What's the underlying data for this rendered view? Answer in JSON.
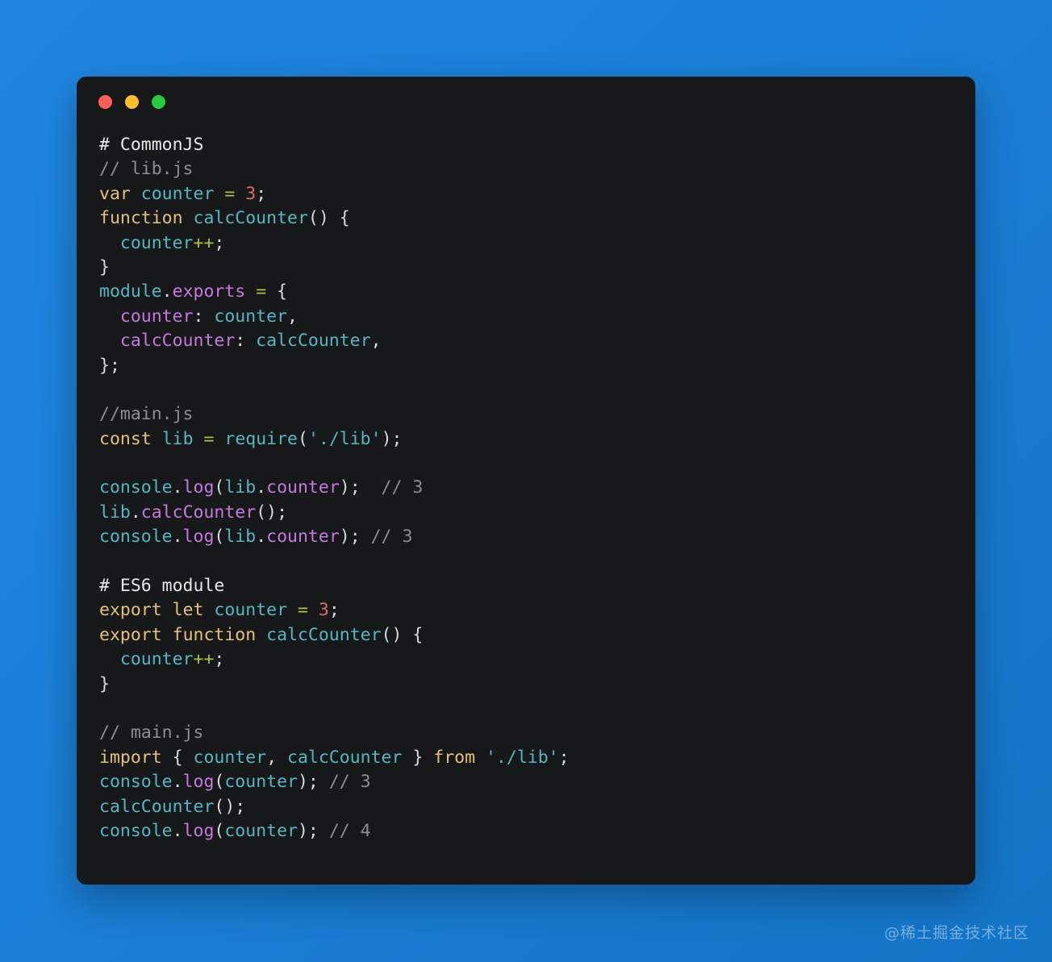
{
  "window": {
    "traffic_lights": [
      {
        "name": "close",
        "color": "#ff5f57"
      },
      {
        "name": "minimize",
        "color": "#febc2e"
      },
      {
        "name": "maximize",
        "color": "#28c840"
      }
    ],
    "background": "#16181a"
  },
  "page": {
    "background_from": "#1f86e0",
    "background_to": "#1474c6",
    "watermark": "@稀土掘金技术社区"
  },
  "code": {
    "language": "javascript",
    "lines": [
      {
        "id": "l01",
        "tokens": [
          {
            "c": "h",
            "t": "# CommonJS"
          }
        ]
      },
      {
        "id": "l02",
        "tokens": [
          {
            "c": "cm",
            "t": "// lib.js"
          }
        ]
      },
      {
        "id": "l03",
        "tokens": [
          {
            "c": "kw",
            "t": "var"
          },
          {
            "c": "pu",
            "t": " "
          },
          {
            "c": "id",
            "t": "counter"
          },
          {
            "c": "pu",
            "t": " "
          },
          {
            "c": "op",
            "t": "="
          },
          {
            "c": "pu",
            "t": " "
          },
          {
            "c": "nu",
            "t": "3"
          },
          {
            "c": "pu",
            "t": ";"
          }
        ]
      },
      {
        "id": "l04",
        "tokens": [
          {
            "c": "kw",
            "t": "function"
          },
          {
            "c": "pu",
            "t": " "
          },
          {
            "c": "id",
            "t": "calcCounter"
          },
          {
            "c": "pu",
            "t": "() {"
          }
        ]
      },
      {
        "id": "l05",
        "tokens": [
          {
            "c": "pu",
            "t": "  "
          },
          {
            "c": "id",
            "t": "counter"
          },
          {
            "c": "op",
            "t": "++"
          },
          {
            "c": "pu",
            "t": ";"
          }
        ]
      },
      {
        "id": "l06",
        "tokens": [
          {
            "c": "pu",
            "t": "}"
          }
        ]
      },
      {
        "id": "l07",
        "tokens": [
          {
            "c": "id",
            "t": "module"
          },
          {
            "c": "pu",
            "t": "."
          },
          {
            "c": "pr",
            "t": "exports"
          },
          {
            "c": "pu",
            "t": " "
          },
          {
            "c": "op",
            "t": "="
          },
          {
            "c": "pu",
            "t": " {"
          }
        ]
      },
      {
        "id": "l08",
        "tokens": [
          {
            "c": "pu",
            "t": "  "
          },
          {
            "c": "pr",
            "t": "counter"
          },
          {
            "c": "pu",
            "t": ": "
          },
          {
            "c": "id",
            "t": "counter"
          },
          {
            "c": "pu",
            "t": ","
          }
        ]
      },
      {
        "id": "l09",
        "tokens": [
          {
            "c": "pu",
            "t": "  "
          },
          {
            "c": "pr",
            "t": "calcCounter"
          },
          {
            "c": "pu",
            "t": ": "
          },
          {
            "c": "id",
            "t": "calcCounter"
          },
          {
            "c": "pu",
            "t": ","
          }
        ]
      },
      {
        "id": "l10",
        "tokens": [
          {
            "c": "pu",
            "t": "};"
          }
        ]
      },
      {
        "id": "l11",
        "tokens": []
      },
      {
        "id": "l12",
        "tokens": [
          {
            "c": "cm",
            "t": "//main.js"
          }
        ]
      },
      {
        "id": "l13",
        "tokens": [
          {
            "c": "kw",
            "t": "const"
          },
          {
            "c": "pu",
            "t": " "
          },
          {
            "c": "id",
            "t": "lib"
          },
          {
            "c": "pu",
            "t": " "
          },
          {
            "c": "op",
            "t": "="
          },
          {
            "c": "pu",
            "t": " "
          },
          {
            "c": "id",
            "t": "require"
          },
          {
            "c": "pu",
            "t": "("
          },
          {
            "c": "id",
            "t": "'./lib'"
          },
          {
            "c": "pu",
            "t": ");"
          }
        ]
      },
      {
        "id": "l14",
        "tokens": []
      },
      {
        "id": "l15",
        "tokens": [
          {
            "c": "id",
            "t": "console"
          },
          {
            "c": "pu",
            "t": "."
          },
          {
            "c": "pr",
            "t": "log"
          },
          {
            "c": "pu",
            "t": "("
          },
          {
            "c": "id",
            "t": "lib"
          },
          {
            "c": "pu",
            "t": "."
          },
          {
            "c": "pr",
            "t": "counter"
          },
          {
            "c": "pu",
            "t": ");  "
          },
          {
            "c": "cm",
            "t": "// 3"
          }
        ]
      },
      {
        "id": "l16",
        "tokens": [
          {
            "c": "id",
            "t": "lib"
          },
          {
            "c": "pu",
            "t": "."
          },
          {
            "c": "pr",
            "t": "calcCounter"
          },
          {
            "c": "pu",
            "t": "();"
          }
        ]
      },
      {
        "id": "l17",
        "tokens": [
          {
            "c": "id",
            "t": "console"
          },
          {
            "c": "pu",
            "t": "."
          },
          {
            "c": "pr",
            "t": "log"
          },
          {
            "c": "pu",
            "t": "("
          },
          {
            "c": "id",
            "t": "lib"
          },
          {
            "c": "pu",
            "t": "."
          },
          {
            "c": "pr",
            "t": "counter"
          },
          {
            "c": "pu",
            "t": "); "
          },
          {
            "c": "cm",
            "t": "// 3"
          }
        ]
      },
      {
        "id": "l18",
        "tokens": []
      },
      {
        "id": "l19",
        "tokens": [
          {
            "c": "h",
            "t": "# ES6 module"
          }
        ]
      },
      {
        "id": "l20",
        "tokens": [
          {
            "c": "kw",
            "t": "export"
          },
          {
            "c": "pu",
            "t": " "
          },
          {
            "c": "kw",
            "t": "let"
          },
          {
            "c": "pu",
            "t": " "
          },
          {
            "c": "id",
            "t": "counter"
          },
          {
            "c": "pu",
            "t": " "
          },
          {
            "c": "op",
            "t": "="
          },
          {
            "c": "pu",
            "t": " "
          },
          {
            "c": "nu",
            "t": "3"
          },
          {
            "c": "pu",
            "t": ";"
          }
        ]
      },
      {
        "id": "l21",
        "tokens": [
          {
            "c": "kw",
            "t": "export"
          },
          {
            "c": "pu",
            "t": " "
          },
          {
            "c": "kw",
            "t": "function"
          },
          {
            "c": "pu",
            "t": " "
          },
          {
            "c": "id",
            "t": "calcCounter"
          },
          {
            "c": "pu",
            "t": "() {"
          }
        ]
      },
      {
        "id": "l22",
        "tokens": [
          {
            "c": "pu",
            "t": "  "
          },
          {
            "c": "id",
            "t": "counter"
          },
          {
            "c": "op",
            "t": "++"
          },
          {
            "c": "pu",
            "t": ";"
          }
        ]
      },
      {
        "id": "l23",
        "tokens": [
          {
            "c": "pu",
            "t": "}"
          }
        ]
      },
      {
        "id": "l24",
        "tokens": []
      },
      {
        "id": "l25",
        "tokens": [
          {
            "c": "cm",
            "t": "// main.js"
          }
        ]
      },
      {
        "id": "l26",
        "tokens": [
          {
            "c": "kw",
            "t": "import"
          },
          {
            "c": "pu",
            "t": " { "
          },
          {
            "c": "id",
            "t": "counter"
          },
          {
            "c": "pu",
            "t": ", "
          },
          {
            "c": "id",
            "t": "calcCounter"
          },
          {
            "c": "pu",
            "t": " } "
          },
          {
            "c": "kw",
            "t": "from"
          },
          {
            "c": "pu",
            "t": " "
          },
          {
            "c": "id",
            "t": "'./lib'"
          },
          {
            "c": "pu",
            "t": ";"
          }
        ]
      },
      {
        "id": "l27",
        "tokens": [
          {
            "c": "id",
            "t": "console"
          },
          {
            "c": "pu",
            "t": "."
          },
          {
            "c": "pr",
            "t": "log"
          },
          {
            "c": "pu",
            "t": "("
          },
          {
            "c": "id",
            "t": "counter"
          },
          {
            "c": "pu",
            "t": "); "
          },
          {
            "c": "cm",
            "t": "// 3"
          }
        ]
      },
      {
        "id": "l28",
        "tokens": [
          {
            "c": "id",
            "t": "calcCounter"
          },
          {
            "c": "pu",
            "t": "();"
          }
        ]
      },
      {
        "id": "l29",
        "tokens": [
          {
            "c": "id",
            "t": "console"
          },
          {
            "c": "pu",
            "t": "."
          },
          {
            "c": "pr",
            "t": "log"
          },
          {
            "c": "pu",
            "t": "("
          },
          {
            "c": "id",
            "t": "counter"
          },
          {
            "c": "pu",
            "t": "); "
          },
          {
            "c": "cm",
            "t": "// 4"
          }
        ]
      }
    ],
    "plain_text": "# CommonJS\n// lib.js\nvar counter = 3;\nfunction calcCounter() {\n  counter++;\n}\nmodule.exports = {\n  counter: counter,\n  calcCounter: calcCounter,\n};\n\n//main.js\nconst lib = require('./lib');\n\nconsole.log(lib.counter);  // 3\nlib.calcCounter();\nconsole.log(lib.counter); // 3\n\n# ES6 module\nexport let counter = 3;\nexport function calcCounter() {\n  counter++;\n}\n\n// main.js\nimport { counter, calcCounter } from './lib';\nconsole.log(counter); // 3\ncalcCounter();\nconsole.log(counter); // 4"
  }
}
